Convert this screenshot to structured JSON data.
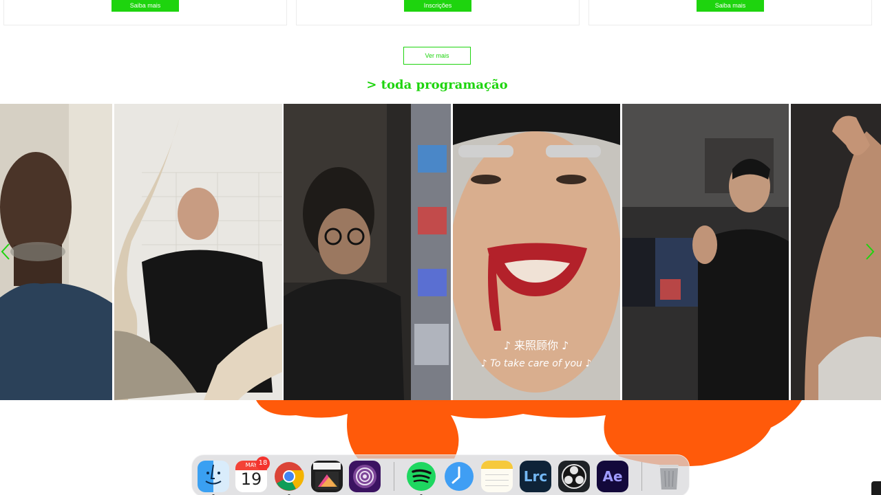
{
  "cards": [
    {
      "button_label": "Saiba mais"
    },
    {
      "button_label": "Inscrições"
    },
    {
      "button_label": "Saiba mais"
    }
  ],
  "ver_mais_label": "Ver mais",
  "section_title": "> toda programação",
  "carousel": {
    "subtitle_zh": "♪ 来照顾你 ♪",
    "subtitle_en": "♪ To take care of you ♪"
  },
  "dock": {
    "calendar_month": "MAY",
    "calendar_day": "19",
    "calendar_badge": "18",
    "lrc_label": "Lrc",
    "ae_label": "Ae"
  },
  "colors": {
    "accent": "#1ed40e",
    "blob": "#ff5a0a"
  }
}
